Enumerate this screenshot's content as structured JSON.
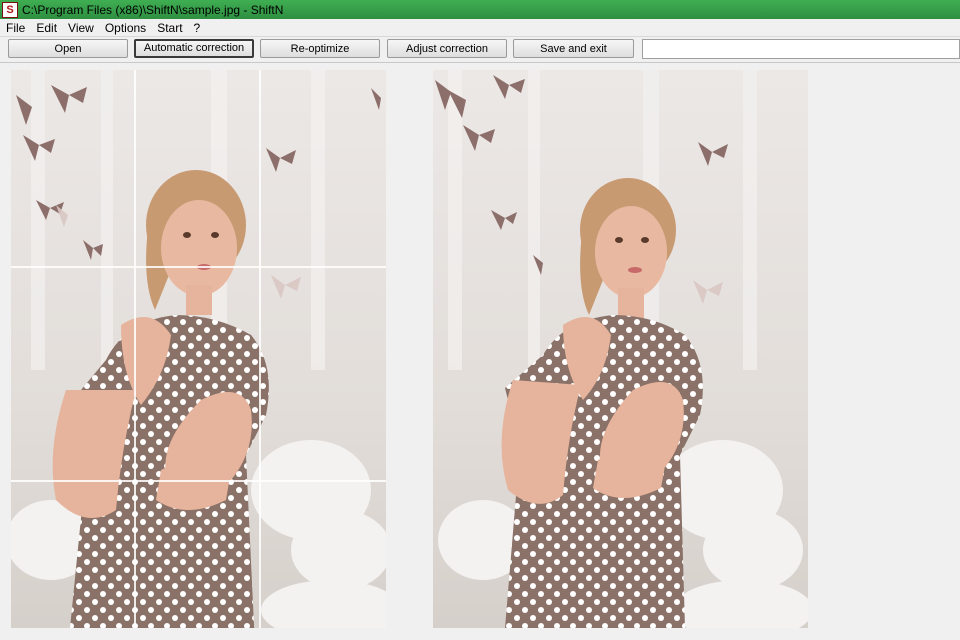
{
  "window": {
    "title": "C:\\Program Files (x86)\\ShiftN\\sample.jpg - ShiftN",
    "icon_letter": "S"
  },
  "menu": {
    "items": [
      {
        "label": "File"
      },
      {
        "label": "Edit"
      },
      {
        "label": "View"
      },
      {
        "label": "Options"
      },
      {
        "label": "Start"
      },
      {
        "label": "?"
      }
    ]
  },
  "toolbar": {
    "open": "Open",
    "automatic_correction": "Automatic correction",
    "reoptimize": "Re-optimize",
    "adjust_correction": "Adjust correction",
    "save_and_exit": "Save and exit"
  },
  "images": {
    "original": {
      "grid": "3x3"
    },
    "corrected": {}
  },
  "colors": {
    "title_bar": "#35a049",
    "dress": "#8a7268",
    "dots": "#ffffff",
    "skin": "#e6b49c",
    "hair": "#c89a72"
  }
}
